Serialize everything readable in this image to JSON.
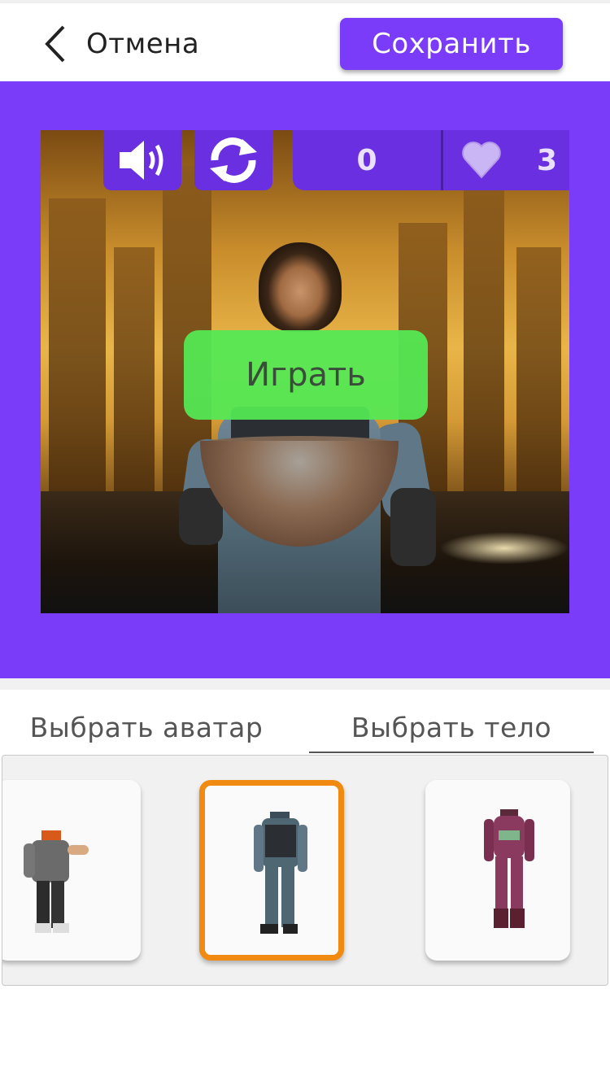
{
  "header": {
    "cancel_label": "Отмена",
    "save_label": "Сохранить"
  },
  "game": {
    "score": "0",
    "lives": "3",
    "play_label": "Играть",
    "sound_icon": "speaker-icon",
    "restart_icon": "refresh-icon",
    "heart_icon": "heart-icon"
  },
  "tabs": [
    {
      "label": "Выбрать аватар",
      "active": false
    },
    {
      "label": "Выбрать тело",
      "active": true
    }
  ],
  "bodies": [
    {
      "name": "body-hoodie",
      "selected": false
    },
    {
      "name": "body-soldier",
      "selected": true
    },
    {
      "name": "body-pink-armor",
      "selected": false
    }
  ],
  "colors": {
    "accent": "#7a3cf9",
    "hud": "#6a2fe0",
    "play": "#54e954",
    "selected_border": "#f08a10"
  }
}
